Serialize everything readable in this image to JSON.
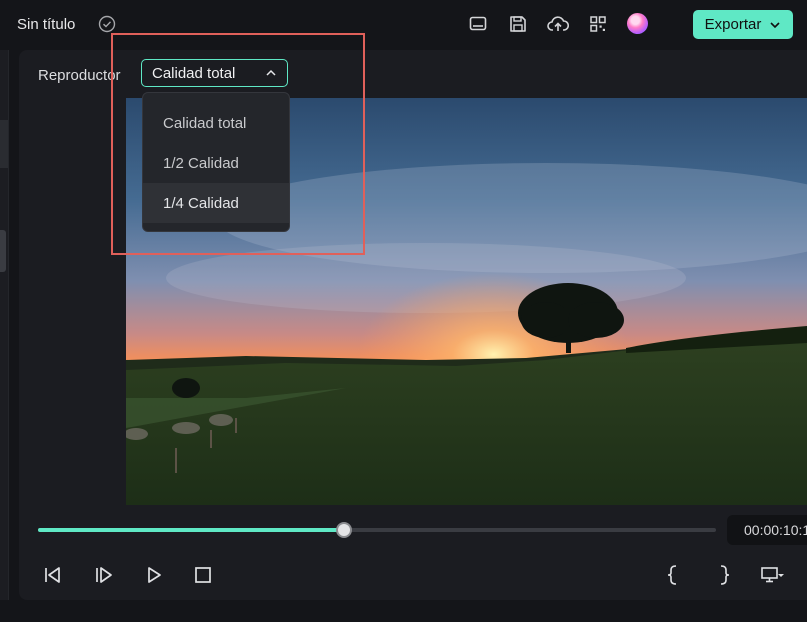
{
  "app": {
    "title": "Sin título"
  },
  "icons": {
    "saved": "check-circle-icon",
    "toolbar": [
      "monitor-icon",
      "save-icon",
      "cloud-upload-icon",
      "qr-grid-icon"
    ],
    "avatar": "avatar"
  },
  "export": {
    "label": "Exportar"
  },
  "player": {
    "label": "Reproductor",
    "quality": {
      "selected": "Calidad total",
      "options": [
        "Calidad total",
        "1/2 Calidad",
        "1/4 Calidad"
      ],
      "hovered_index": 2
    }
  },
  "playback": {
    "progress": 0.45,
    "timecode": "00:00:10:1"
  },
  "controls": [
    "previous-frame",
    "next-frame",
    "play",
    "stop",
    "mark-in",
    "mark-out",
    "display-settings"
  ],
  "colors": {
    "accent": "#5fe8c5",
    "highlight": "#e0605a",
    "panel": "#1b1c21"
  }
}
